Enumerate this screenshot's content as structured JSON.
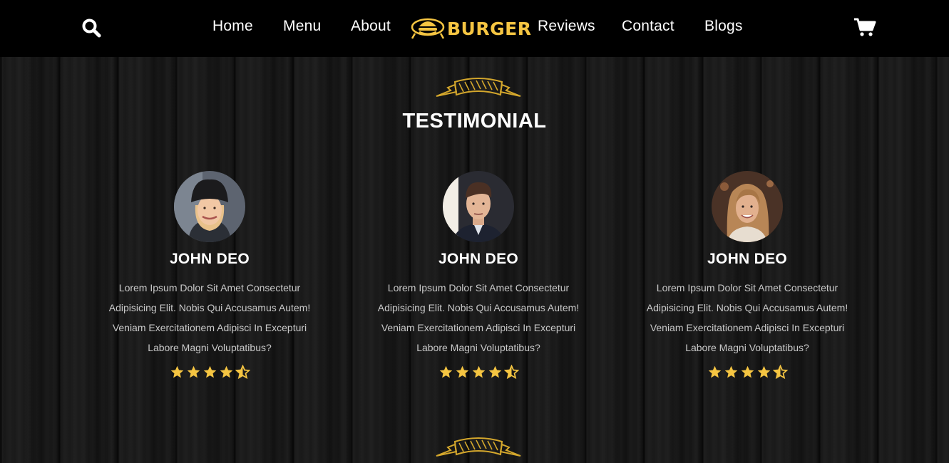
{
  "header": {
    "nav_left": [
      {
        "label": "Home"
      },
      {
        "label": "Menu"
      },
      {
        "label": "About"
      }
    ],
    "logo_text": "BURGER",
    "nav_right": [
      {
        "label": "Reviews"
      },
      {
        "label": "Contact"
      },
      {
        "label": "Blogs"
      }
    ],
    "search_icon": "search-icon",
    "cart_icon": "cart-icon"
  },
  "testimonial": {
    "title": "TESTIMONIAL",
    "cards": [
      {
        "name": "JOHN DEO",
        "text": "Lorem Ipsum Dolor Sit Amet Consectetur Adipisicing Elit. Nobis Qui Accusamus Autem! Veniam Exercitationem Adipisci In Excepturi Labore Magni Voluptatibus?",
        "rating": 4.5,
        "avatar": "woman-in-black-beanie"
      },
      {
        "name": "JOHN DEO",
        "text": "Lorem Ipsum Dolor Sit Amet Consectetur Adipisicing Elit. Nobis Qui Accusamus Autem! Veniam Exercitationem Adipisci In Excepturi Labore Magni Voluptatibus?",
        "rating": 4.5,
        "avatar": "man-in-dark-suit"
      },
      {
        "name": "JOHN DEO",
        "text": "Lorem Ipsum Dolor Sit Amet Consectetur Adipisicing Elit. Nobis Qui Accusamus Autem! Veniam Exercitationem Adipisci In Excepturi Labore Magni Voluptatibus?",
        "rating": 4.5,
        "avatar": "smiling-woman-curly-hair"
      }
    ]
  },
  "colors": {
    "accent": "#f5c542",
    "header_bg": "#000000",
    "text_muted": "#c9c9c9"
  }
}
